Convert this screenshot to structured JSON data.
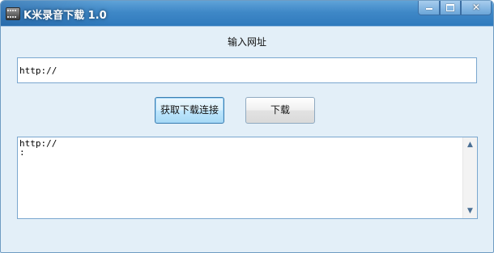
{
  "window": {
    "title": "K米录音下载 1.0",
    "icon": "film-strip-icon",
    "controls": {
      "minimize": "minimize-icon",
      "maximize": "maximize-icon",
      "close": "close-icon",
      "close_glyph": "✕"
    }
  },
  "form": {
    "url_label": "输入网址",
    "url_value": "http://"
  },
  "buttons": {
    "fetch_label": "获取下载连接",
    "download_label": "下载"
  },
  "output": {
    "text": "http://\n:"
  },
  "scrollbar": {
    "up_glyph": "▲",
    "down_glyph": "▼"
  },
  "colors": {
    "titlebar": "#3f88c7",
    "window_bg": "#e3eff8",
    "input_border": "#7aa7cf"
  }
}
